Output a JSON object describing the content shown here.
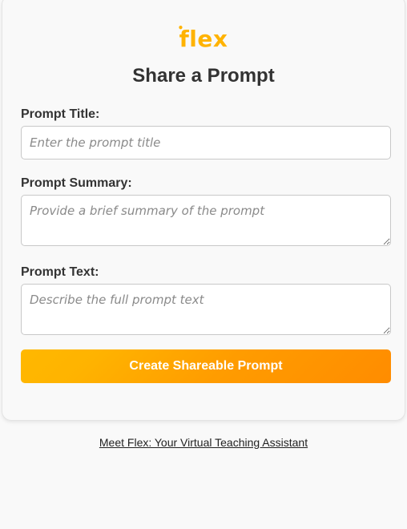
{
  "brand": {
    "logo_text": "flex",
    "logo_dot": "•",
    "accent_color": "#ffb300",
    "button_gradient": [
      "#ffb800",
      "#ff8c00"
    ]
  },
  "form": {
    "title": "Share a Prompt",
    "prompt_title": {
      "label": "Prompt Title:",
      "placeholder": "Enter the prompt title",
      "value": ""
    },
    "prompt_summary": {
      "label": "Prompt Summary:",
      "placeholder": "Provide a brief summary of the prompt",
      "value": ""
    },
    "prompt_text": {
      "label": "Prompt Text:",
      "placeholder": "Describe the full prompt text",
      "value": ""
    },
    "submit_label": "Create Shareable Prompt"
  },
  "footer": {
    "link_text": "Meet Flex: Your Virtual Teaching Assistant"
  }
}
